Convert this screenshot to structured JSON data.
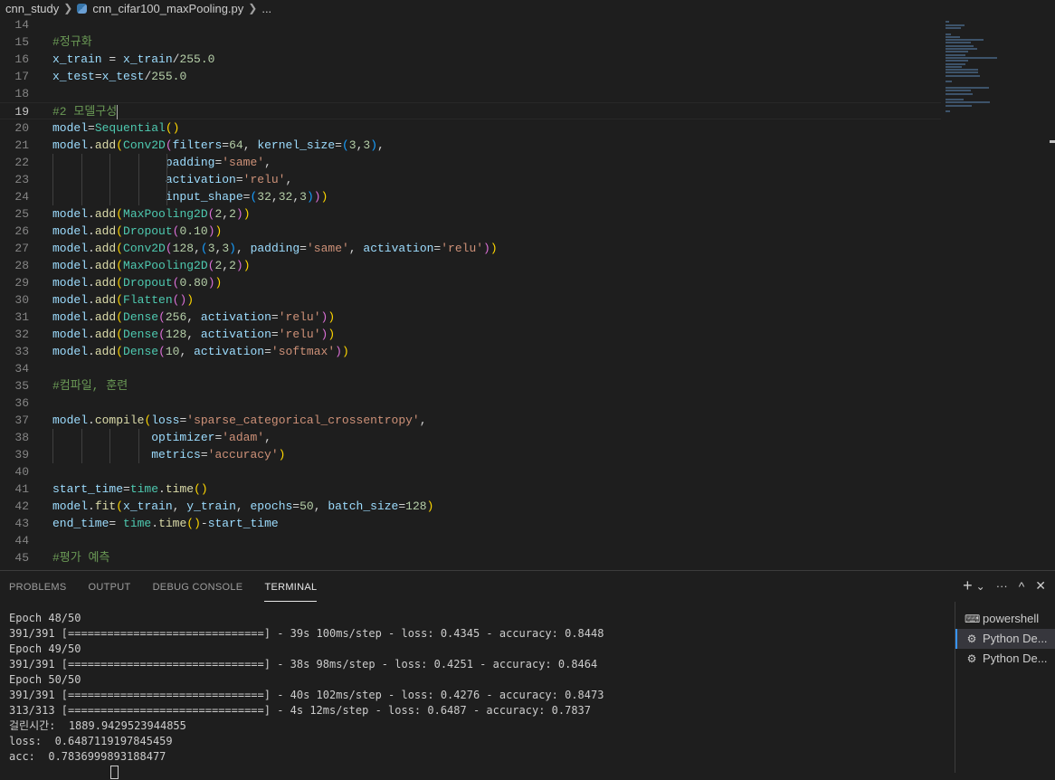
{
  "breadcrumb": {
    "folder": "cnn_study",
    "file": "cnn_cifar100_maxPooling.py",
    "ellipsis": "..."
  },
  "editor": {
    "current_line": 19,
    "lines": [
      {
        "n": "14",
        "t": []
      },
      {
        "n": "15",
        "t": [
          [
            "#정규화",
            "comment"
          ]
        ]
      },
      {
        "n": "16",
        "t": [
          [
            "x_train",
            "var"
          ],
          [
            " = ",
            "op"
          ],
          [
            "x_train",
            "var"
          ],
          [
            "/",
            "op"
          ],
          [
            "255.0",
            "num"
          ]
        ]
      },
      {
        "n": "17",
        "t": [
          [
            "x_test",
            "var"
          ],
          [
            "=",
            "op"
          ],
          [
            "x_test",
            "var"
          ],
          [
            "/",
            "op"
          ],
          [
            "255.0",
            "num"
          ]
        ]
      },
      {
        "n": "18",
        "t": []
      },
      {
        "n": "19",
        "t": [
          [
            "#2 모델구성",
            "comment"
          ]
        ],
        "cursor": true
      },
      {
        "n": "20",
        "t": [
          [
            "model",
            "var"
          ],
          [
            "=",
            "op"
          ],
          [
            "Sequential",
            "class"
          ],
          [
            "()",
            "b1"
          ]
        ]
      },
      {
        "n": "21",
        "t": [
          [
            "model",
            "var"
          ],
          [
            ".",
            "op"
          ],
          [
            "add",
            "func"
          ],
          [
            "(",
            "b1"
          ],
          [
            "Conv2D",
            "class"
          ],
          [
            "(",
            "b2"
          ],
          [
            "filters",
            "var"
          ],
          [
            "=",
            "op"
          ],
          [
            "64",
            "num"
          ],
          [
            ", ",
            "op"
          ],
          [
            "kernel_size",
            "var"
          ],
          [
            "=",
            "op"
          ],
          [
            "(",
            "b3"
          ],
          [
            "3",
            "num"
          ],
          [
            ",",
            "op"
          ],
          [
            "3",
            "num"
          ],
          [
            ")",
            "b3"
          ],
          [
            ",",
            "op"
          ]
        ]
      },
      {
        "n": "22",
        "t": [
          [
            "                ",
            "op"
          ],
          [
            "padding",
            "var"
          ],
          [
            "=",
            "op"
          ],
          [
            "'same'",
            "str"
          ],
          [
            ",",
            "op"
          ]
        ],
        "guides": 5
      },
      {
        "n": "23",
        "t": [
          [
            "                ",
            "op"
          ],
          [
            "activation",
            "var"
          ],
          [
            "=",
            "op"
          ],
          [
            "'relu'",
            "str"
          ],
          [
            ",",
            "op"
          ]
        ],
        "guides": 5
      },
      {
        "n": "24",
        "t": [
          [
            "                ",
            "op"
          ],
          [
            "input_shape",
            "var"
          ],
          [
            "=",
            "op"
          ],
          [
            "(",
            "b3"
          ],
          [
            "32",
            "num"
          ],
          [
            ",",
            "op"
          ],
          [
            "32",
            "num"
          ],
          [
            ",",
            "op"
          ],
          [
            "3",
            "num"
          ],
          [
            ")",
            "b3"
          ],
          [
            ")",
            "b2"
          ],
          [
            ")",
            "b1"
          ]
        ],
        "guides": 5
      },
      {
        "n": "25",
        "t": [
          [
            "model",
            "var"
          ],
          [
            ".",
            "op"
          ],
          [
            "add",
            "func"
          ],
          [
            "(",
            "b1"
          ],
          [
            "MaxPooling2D",
            "class"
          ],
          [
            "(",
            "b2"
          ],
          [
            "2",
            "num"
          ],
          [
            ",",
            "op"
          ],
          [
            "2",
            "num"
          ],
          [
            ")",
            "b2"
          ],
          [
            ")",
            "b1"
          ]
        ]
      },
      {
        "n": "26",
        "t": [
          [
            "model",
            "var"
          ],
          [
            ".",
            "op"
          ],
          [
            "add",
            "func"
          ],
          [
            "(",
            "b1"
          ],
          [
            "Dropout",
            "class"
          ],
          [
            "(",
            "b2"
          ],
          [
            "0.10",
            "num"
          ],
          [
            ")",
            "b2"
          ],
          [
            ")",
            "b1"
          ]
        ]
      },
      {
        "n": "27",
        "t": [
          [
            "model",
            "var"
          ],
          [
            ".",
            "op"
          ],
          [
            "add",
            "func"
          ],
          [
            "(",
            "b1"
          ],
          [
            "Conv2D",
            "class"
          ],
          [
            "(",
            "b2"
          ],
          [
            "128",
            "num"
          ],
          [
            ",",
            "op"
          ],
          [
            "(",
            "b3"
          ],
          [
            "3",
            "num"
          ],
          [
            ",",
            "op"
          ],
          [
            "3",
            "num"
          ],
          [
            ")",
            "b3"
          ],
          [
            ", ",
            "op"
          ],
          [
            "padding",
            "var"
          ],
          [
            "=",
            "op"
          ],
          [
            "'same'",
            "str"
          ],
          [
            ", ",
            "op"
          ],
          [
            "activation",
            "var"
          ],
          [
            "=",
            "op"
          ],
          [
            "'relu'",
            "str"
          ],
          [
            ")",
            "b2"
          ],
          [
            ")",
            "b1"
          ]
        ]
      },
      {
        "n": "28",
        "t": [
          [
            "model",
            "var"
          ],
          [
            ".",
            "op"
          ],
          [
            "add",
            "func"
          ],
          [
            "(",
            "b1"
          ],
          [
            "MaxPooling2D",
            "class"
          ],
          [
            "(",
            "b2"
          ],
          [
            "2",
            "num"
          ],
          [
            ",",
            "op"
          ],
          [
            "2",
            "num"
          ],
          [
            ")",
            "b2"
          ],
          [
            ")",
            "b1"
          ]
        ]
      },
      {
        "n": "29",
        "t": [
          [
            "model",
            "var"
          ],
          [
            ".",
            "op"
          ],
          [
            "add",
            "func"
          ],
          [
            "(",
            "b1"
          ],
          [
            "Dropout",
            "class"
          ],
          [
            "(",
            "b2"
          ],
          [
            "0.80",
            "num"
          ],
          [
            ")",
            "b2"
          ],
          [
            ")",
            "b1"
          ]
        ]
      },
      {
        "n": "30",
        "t": [
          [
            "model",
            "var"
          ],
          [
            ".",
            "op"
          ],
          [
            "add",
            "func"
          ],
          [
            "(",
            "b1"
          ],
          [
            "Flatten",
            "class"
          ],
          [
            "()",
            "b2"
          ],
          [
            ")",
            "b1"
          ]
        ]
      },
      {
        "n": "31",
        "t": [
          [
            "model",
            "var"
          ],
          [
            ".",
            "op"
          ],
          [
            "add",
            "func"
          ],
          [
            "(",
            "b1"
          ],
          [
            "Dense",
            "class"
          ],
          [
            "(",
            "b2"
          ],
          [
            "256",
            "num"
          ],
          [
            ", ",
            "op"
          ],
          [
            "activation",
            "var"
          ],
          [
            "=",
            "op"
          ],
          [
            "'relu'",
            "str"
          ],
          [
            ")",
            "b2"
          ],
          [
            ")",
            "b1"
          ]
        ]
      },
      {
        "n": "32",
        "t": [
          [
            "model",
            "var"
          ],
          [
            ".",
            "op"
          ],
          [
            "add",
            "func"
          ],
          [
            "(",
            "b1"
          ],
          [
            "Dense",
            "class"
          ],
          [
            "(",
            "b2"
          ],
          [
            "128",
            "num"
          ],
          [
            ", ",
            "op"
          ],
          [
            "activation",
            "var"
          ],
          [
            "=",
            "op"
          ],
          [
            "'relu'",
            "str"
          ],
          [
            ")",
            "b2"
          ],
          [
            ")",
            "b1"
          ]
        ]
      },
      {
        "n": "33",
        "t": [
          [
            "model",
            "var"
          ],
          [
            ".",
            "op"
          ],
          [
            "add",
            "func"
          ],
          [
            "(",
            "b1"
          ],
          [
            "Dense",
            "class"
          ],
          [
            "(",
            "b2"
          ],
          [
            "10",
            "num"
          ],
          [
            ", ",
            "op"
          ],
          [
            "activation",
            "var"
          ],
          [
            "=",
            "op"
          ],
          [
            "'softmax'",
            "str"
          ],
          [
            ")",
            "b2"
          ],
          [
            ")",
            "b1"
          ]
        ]
      },
      {
        "n": "34",
        "t": []
      },
      {
        "n": "35",
        "t": [
          [
            "#컴파일, 훈련",
            "comment"
          ]
        ]
      },
      {
        "n": "36",
        "t": []
      },
      {
        "n": "37",
        "t": [
          [
            "model",
            "var"
          ],
          [
            ".",
            "op"
          ],
          [
            "compile",
            "func"
          ],
          [
            "(",
            "b1"
          ],
          [
            "loss",
            "var"
          ],
          [
            "=",
            "op"
          ],
          [
            "'sparse_categorical_crossentropy'",
            "str"
          ],
          [
            ",",
            "op"
          ]
        ]
      },
      {
        "n": "38",
        "t": [
          [
            "              ",
            "op"
          ],
          [
            "optimizer",
            "var"
          ],
          [
            "=",
            "op"
          ],
          [
            "'adam'",
            "str"
          ],
          [
            ",",
            "op"
          ]
        ],
        "guides": 4
      },
      {
        "n": "39",
        "t": [
          [
            "              ",
            "op"
          ],
          [
            "metrics",
            "var"
          ],
          [
            "=",
            "op"
          ],
          [
            "'accuracy'",
            "str"
          ],
          [
            ")",
            "b1"
          ]
        ],
        "guides": 4
      },
      {
        "n": "40",
        "t": []
      },
      {
        "n": "41",
        "t": [
          [
            "start_time",
            "var"
          ],
          [
            "=",
            "op"
          ],
          [
            "time",
            "class"
          ],
          [
            ".",
            "op"
          ],
          [
            "time",
            "func"
          ],
          [
            "()",
            "b1"
          ]
        ]
      },
      {
        "n": "42",
        "t": [
          [
            "model",
            "var"
          ],
          [
            ".",
            "op"
          ],
          [
            "fit",
            "func"
          ],
          [
            "(",
            "b1"
          ],
          [
            "x_train",
            "var"
          ],
          [
            ", ",
            "op"
          ],
          [
            "y_train",
            "var"
          ],
          [
            ", ",
            "op"
          ],
          [
            "epochs",
            "var"
          ],
          [
            "=",
            "op"
          ],
          [
            "50",
            "num"
          ],
          [
            ", ",
            "op"
          ],
          [
            "batch_size",
            "var"
          ],
          [
            "=",
            "op"
          ],
          [
            "128",
            "num"
          ],
          [
            ")",
            "b1"
          ]
        ]
      },
      {
        "n": "43",
        "t": [
          [
            "end_time",
            "var"
          ],
          [
            "= ",
            "op"
          ],
          [
            "time",
            "class"
          ],
          [
            ".",
            "op"
          ],
          [
            "time",
            "func"
          ],
          [
            "()",
            "b1"
          ],
          [
            "-",
            "op"
          ],
          [
            "start_time",
            "var"
          ]
        ]
      },
      {
        "n": "44",
        "t": []
      },
      {
        "n": "45",
        "t": [
          [
            "#평가 예측",
            "comment"
          ]
        ]
      }
    ]
  },
  "panel": {
    "tabs": [
      "PROBLEMS",
      "OUTPUT",
      "DEBUG CONSOLE",
      "TERMINAL"
    ],
    "active_tab": "TERMINAL",
    "actions": {
      "add": "+",
      "chevron": "⌄",
      "more": "···",
      "maximize": "^",
      "close": "✕"
    }
  },
  "terminal": {
    "lines": [
      "Epoch 48/50",
      "391/391 [==============================] - 39s 100ms/step - loss: 0.4345 - accuracy: 0.8448",
      "Epoch 49/50",
      "391/391 [==============================] - 38s 98ms/step - loss: 0.4251 - accuracy: 0.8464",
      "Epoch 50/50",
      "391/391 [==============================] - 40s 102ms/step - loss: 0.4276 - accuracy: 0.8473",
      "313/313 [==============================] - 4s 12ms/step - loss: 0.6487 - accuracy: 0.7837",
      "걸린시간:  1889.9429523944855",
      "loss:  0.6487119197845459",
      "acc:  0.7836999893188477"
    ],
    "instances": [
      {
        "label": "powershell",
        "icon": "terminal-icon",
        "selected": false
      },
      {
        "label": "Python De...",
        "icon": "debug-icon",
        "selected": true
      },
      {
        "label": "Python De...",
        "icon": "debug-icon",
        "selected": false
      }
    ]
  },
  "colors": {
    "background": "#1e1e1e",
    "comment": "#6a9955",
    "string": "#ce9178",
    "number": "#b5cea8",
    "function": "#dcdcaa",
    "class": "#4ec9b0",
    "variable": "#9cdcfe",
    "accent": "#3794ff"
  }
}
